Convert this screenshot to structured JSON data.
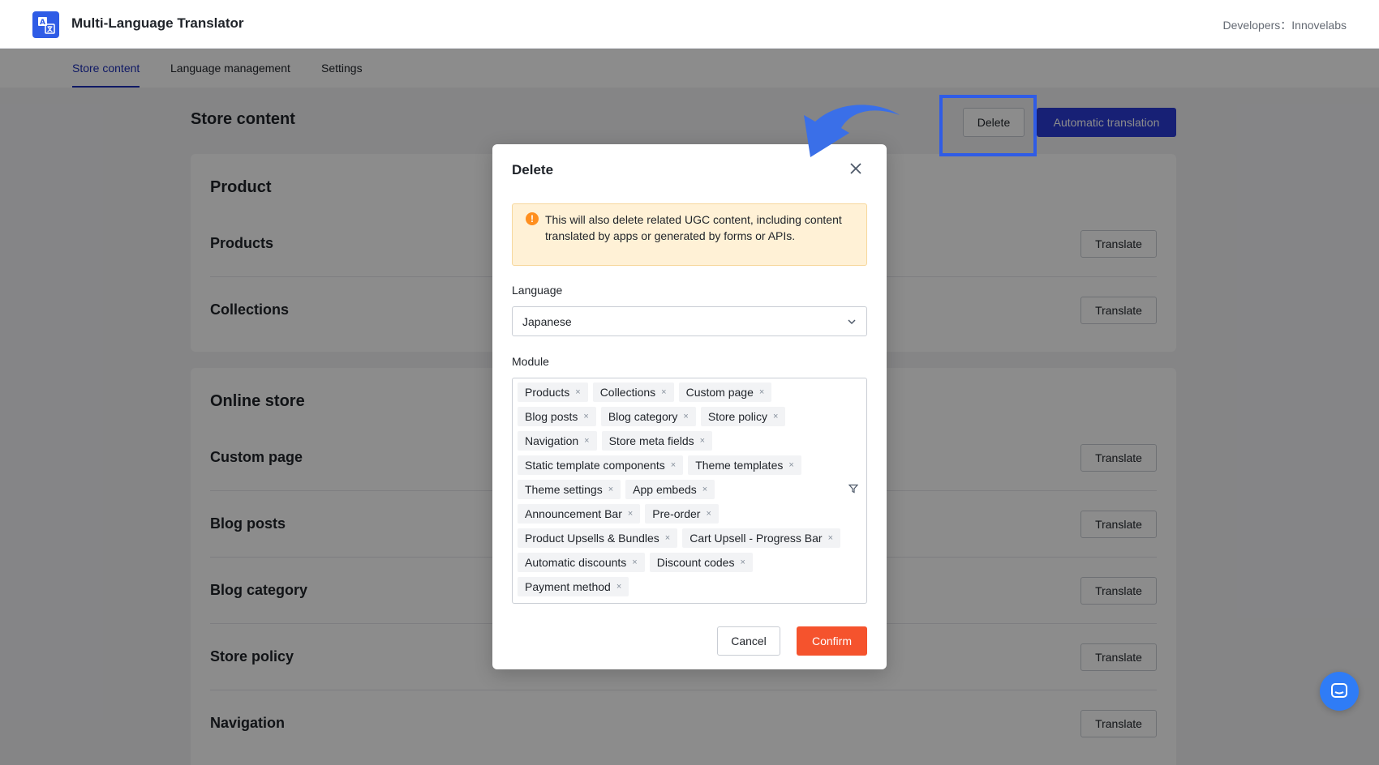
{
  "header": {
    "app_title": "Multi-Language Translator",
    "developer": "Developers：Innovelabs"
  },
  "nav": {
    "tabs": [
      {
        "label": "Store content",
        "active": true
      },
      {
        "label": "Language management",
        "active": false
      },
      {
        "label": "Settings",
        "active": false
      }
    ]
  },
  "page": {
    "title": "Store content",
    "delete_label": "Delete",
    "auto_translate_label": "Automatic translation",
    "translate_label": "Translate"
  },
  "sections": [
    {
      "title": "Product",
      "items": [
        "Products",
        "Collections"
      ]
    },
    {
      "title": "Online store",
      "items": [
        "Custom page",
        "Blog posts",
        "Blog category",
        "Store policy",
        "Navigation"
      ]
    }
  ],
  "modal": {
    "title": "Delete",
    "warning": "This will also delete related UGC content, including content translated by apps or generated by forms or APIs.",
    "language_label": "Language",
    "language_value": "Japanese",
    "module_label": "Module",
    "modules": [
      "Products",
      "Collections",
      "Custom page",
      "Blog posts",
      "Blog category",
      "Store policy",
      "Navigation",
      "Store meta fields",
      "Static template components",
      "Theme templates",
      "Theme settings",
      "App embeds",
      "Announcement Bar",
      "Pre-order",
      "Product Upsells & Bundles",
      "Cart Upsell - Progress Bar",
      "Automatic discounts",
      "Discount codes",
      "Payment method"
    ],
    "cancel_label": "Cancel",
    "confirm_label": "Confirm"
  },
  "colors": {
    "primary": "#2b3bd6",
    "danger": "#f5532d",
    "warning_bg": "#fff1d6",
    "highlight": "#2f5ce6"
  }
}
